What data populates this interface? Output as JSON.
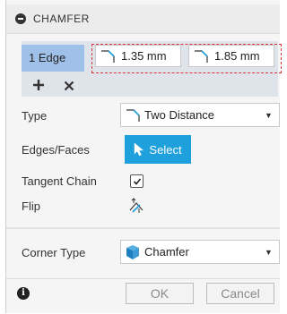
{
  "header": {
    "title": "CHAMFER"
  },
  "selection": {
    "edge_label": "1 Edge",
    "distance1": "1.35 mm",
    "distance2": "1.85 mm",
    "add_icon": "plus-icon",
    "remove_icon": "close-icon"
  },
  "type": {
    "label": "Type",
    "value": "Two Distance"
  },
  "edges_faces": {
    "label": "Edges/Faces",
    "button": "Select"
  },
  "tangent_chain": {
    "label": "Tangent Chain",
    "checked": true
  },
  "flip": {
    "label": "Flip"
  },
  "corner_type": {
    "label": "Corner Type",
    "value": "Chamfer"
  },
  "footer": {
    "ok": "OK",
    "cancel": "Cancel"
  },
  "colors": {
    "accent": "#1ea0dd",
    "selected_row": "#9fc0e8",
    "highlight": "#e03030"
  }
}
